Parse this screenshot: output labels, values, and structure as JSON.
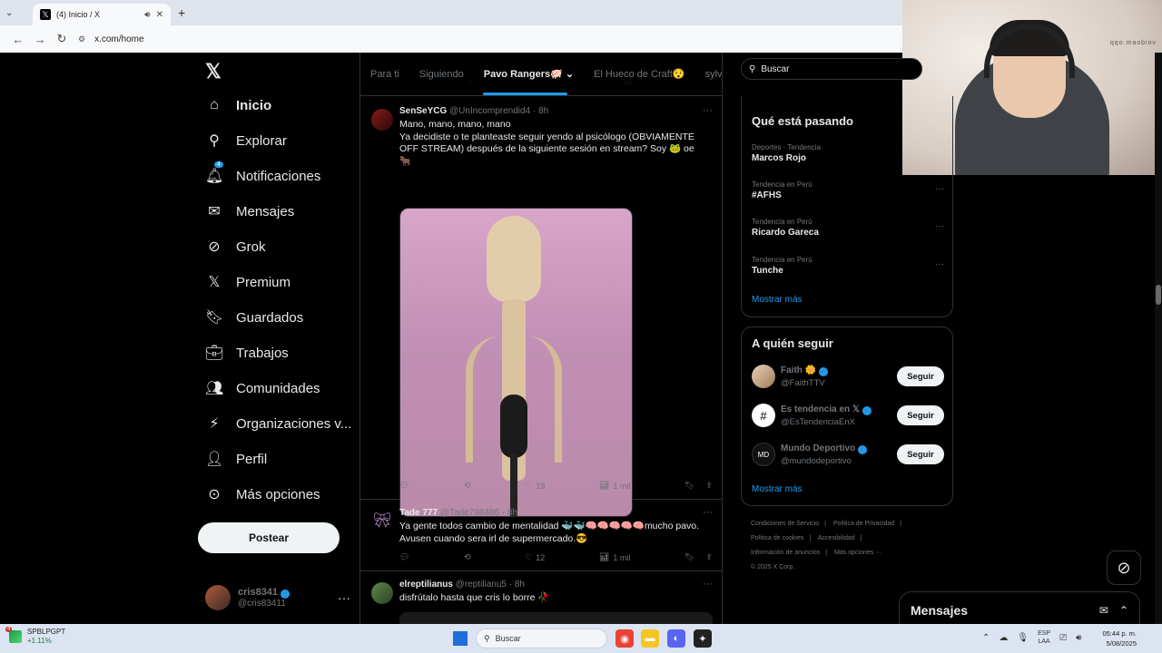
{
  "browser": {
    "tab_title": "(4) Inicio / X",
    "url": "x.com/home"
  },
  "webcam": {
    "watermark": "qqo.maobiov"
  },
  "nav": {
    "items": [
      {
        "label": "Inicio",
        "icon": "home-icon"
      },
      {
        "label": "Explorar",
        "icon": "search-icon"
      },
      {
        "label": "Notificaciones",
        "icon": "bell-icon",
        "badge": "4"
      },
      {
        "label": "Mensajes",
        "icon": "mail-icon"
      },
      {
        "label": "Grok",
        "icon": "grok-icon"
      },
      {
        "label": "Premium",
        "icon": "x-icon"
      },
      {
        "label": "Guardados",
        "icon": "bookmark-icon"
      },
      {
        "label": "Trabajos",
        "icon": "briefcase-icon"
      },
      {
        "label": "Comunidades",
        "icon": "people-icon"
      },
      {
        "label": "Organizaciones v...",
        "icon": "lightning-icon"
      },
      {
        "label": "Perfil",
        "icon": "person-icon"
      },
      {
        "label": "Más opciones",
        "icon": "more-circle-icon"
      }
    ],
    "post_label": "Postear",
    "profile": {
      "name": "cris8341",
      "handle": "@cris83411"
    }
  },
  "timeline": {
    "tabs": [
      "Para ti",
      "Siguiendo",
      "Pavo Rangers🐖",
      "El Hueco de Craft😯",
      "sylville"
    ],
    "tweets": [
      {
        "name": "SenSeYCG",
        "handle": "@UnIncomprendid4",
        "time": "· 8h",
        "text1": "Mano, mano, mano, mano",
        "text2": "Ya decidiste o te planteaste seguir yendo al psicólogo (OBVIAMENTE OFF STREAM) después de la siguiente sesión en stream? Soy 🐸 oe 🐂",
        "likes": "19",
        "views": "1 mil"
      },
      {
        "name": "Tade 777",
        "handle": "@Tade798486",
        "time": "· 8h",
        "text": "Ya gente todos cambio de mentalidad 🐳🐳🧠🧠🧠🧠🧠mucho pavo. Avusen cuando sera irl de supermercado.😎",
        "likes": "12",
        "views": "1 mil"
      },
      {
        "name": "elreptilianus",
        "handle": "@reptilianu5",
        "time": "· 8h",
        "text": "disfrútalo hasta que cris lo borre 🥀"
      }
    ]
  },
  "right": {
    "search_placeholder": "Buscar",
    "trending_title": "Qué está pasando",
    "trends": [
      {
        "category": "Deportes · Tendencia",
        "name": "Marcos Rojo"
      },
      {
        "category": "Tendencia en Perú",
        "name": "#AFHS"
      },
      {
        "category": "Tendencia en Perú",
        "name": "Ricardo Gareca"
      },
      {
        "category": "Tendencia en Perú",
        "name": "Tunche"
      }
    ],
    "show_more": "Mostrar más",
    "follow_title": "A quién seguir",
    "follows": [
      {
        "name": "Faith 🌼",
        "handle": "@FaithTTV",
        "button": "Seguir"
      },
      {
        "name": "Es tendencia en 𝕏",
        "handle": "@EsTendenciaEnX",
        "button": "Seguir"
      },
      {
        "name": "Mundo Deportivo",
        "handle": "@mundodeportivo",
        "button": "Seguir"
      }
    ],
    "footer": [
      "Condiciones de Servicio",
      "Política de Privacidad",
      "Política de cookies",
      "Accesibilidad",
      "Información de anuncios",
      "Más opciones ···",
      "© 2025 X Corp."
    ]
  },
  "messages_drawer": {
    "title": "Mensajes"
  },
  "taskbar": {
    "stock_name": "SPBLPGPT",
    "stock_change": "+1.11%",
    "stock_badge": "4",
    "search": "Buscar",
    "lang_top": "ESP",
    "lang_bottom": "LAA",
    "time": "05:44 p. m.",
    "date": "5/08/2025"
  }
}
